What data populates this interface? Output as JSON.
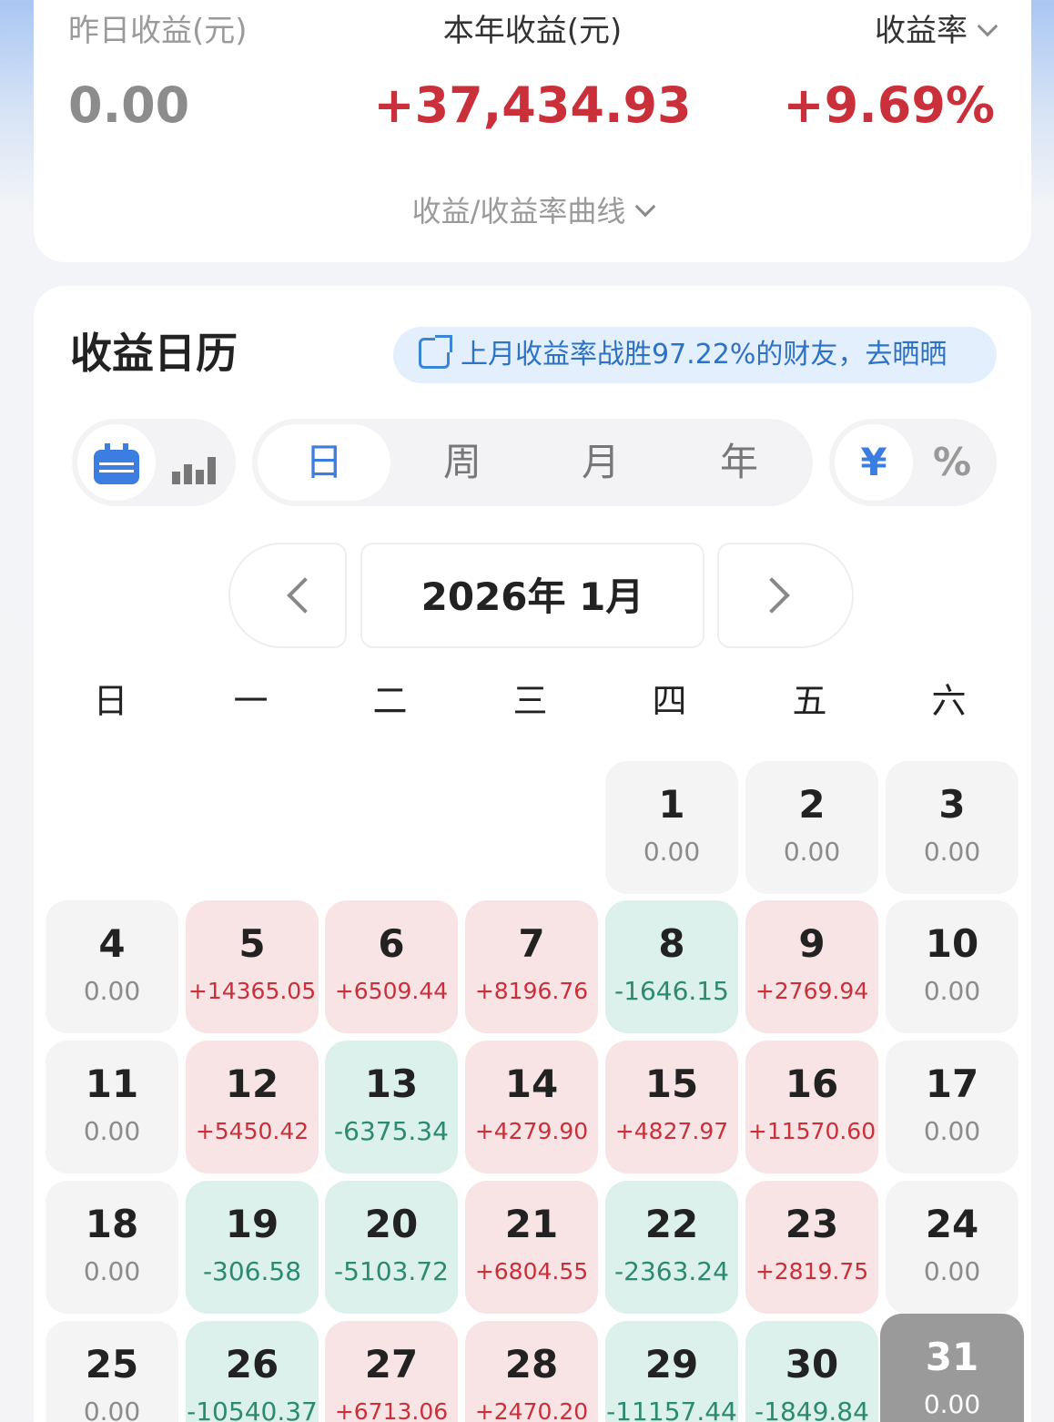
{
  "summary": {
    "yesterday_label": "昨日收益(元)",
    "yesterday_value": "0.00",
    "year_label": "本年收益(元)",
    "year_value": "+37,434.93",
    "rate_label": "收益率",
    "rate_value": "+9.69%",
    "curve_toggle_label": "收益/收益率曲线"
  },
  "calendar": {
    "title": "收益日历",
    "share_banner": "上月收益率战胜97.22%的财友，去晒晒",
    "view_toggle": [
      "calendar-icon",
      "bar-chart-icon"
    ],
    "period_tabs": [
      "日",
      "周",
      "月",
      "年"
    ],
    "active_period": "日",
    "unit_toggle": [
      "¥",
      "%"
    ],
    "active_unit": "¥",
    "month_label": "2026年 1月",
    "weekdays": [
      "日",
      "一",
      "二",
      "三",
      "四",
      "五",
      "六"
    ],
    "days": [
      {
        "day": "1",
        "value": "0.00",
        "status": "zero"
      },
      {
        "day": "2",
        "value": "0.00",
        "status": "zero"
      },
      {
        "day": "3",
        "value": "0.00",
        "status": "zero"
      },
      {
        "day": "4",
        "value": "0.00",
        "status": "zero"
      },
      {
        "day": "5",
        "value": "+14365.05",
        "status": "pos"
      },
      {
        "day": "6",
        "value": "+6509.44",
        "status": "pos"
      },
      {
        "day": "7",
        "value": "+8196.76",
        "status": "pos"
      },
      {
        "day": "8",
        "value": "-1646.15",
        "status": "neg"
      },
      {
        "day": "9",
        "value": "+2769.94",
        "status": "pos"
      },
      {
        "day": "10",
        "value": "0.00",
        "status": "zero"
      },
      {
        "day": "11",
        "value": "0.00",
        "status": "zero"
      },
      {
        "day": "12",
        "value": "+5450.42",
        "status": "pos"
      },
      {
        "day": "13",
        "value": "-6375.34",
        "status": "neg"
      },
      {
        "day": "14",
        "value": "+4279.90",
        "status": "pos"
      },
      {
        "day": "15",
        "value": "+4827.97",
        "status": "pos"
      },
      {
        "day": "16",
        "value": "+11570.60",
        "status": "pos"
      },
      {
        "day": "17",
        "value": "0.00",
        "status": "zero"
      },
      {
        "day": "18",
        "value": "0.00",
        "status": "zero"
      },
      {
        "day": "19",
        "value": "-306.58",
        "status": "neg"
      },
      {
        "day": "20",
        "value": "-5103.72",
        "status": "neg"
      },
      {
        "day": "21",
        "value": "+6804.55",
        "status": "pos"
      },
      {
        "day": "22",
        "value": "-2363.24",
        "status": "neg"
      },
      {
        "day": "23",
        "value": "+2819.75",
        "status": "pos"
      },
      {
        "day": "24",
        "value": "0.00",
        "status": "zero"
      },
      {
        "day": "25",
        "value": "0.00",
        "status": "zero"
      },
      {
        "day": "26",
        "value": "-10540.37",
        "status": "neg"
      },
      {
        "day": "27",
        "value": "+6713.06",
        "status": "pos"
      },
      {
        "day": "28",
        "value": "+2470.20",
        "status": "pos"
      },
      {
        "day": "29",
        "value": "-11157.44",
        "status": "neg"
      },
      {
        "day": "30",
        "value": "-1849.84",
        "status": "neg"
      },
      {
        "day": "31",
        "value": "0.00",
        "status": "today"
      }
    ]
  },
  "colors": {
    "positive": "#c9303a",
    "negative": "#2c8a70",
    "accent": "#3b7de0"
  }
}
